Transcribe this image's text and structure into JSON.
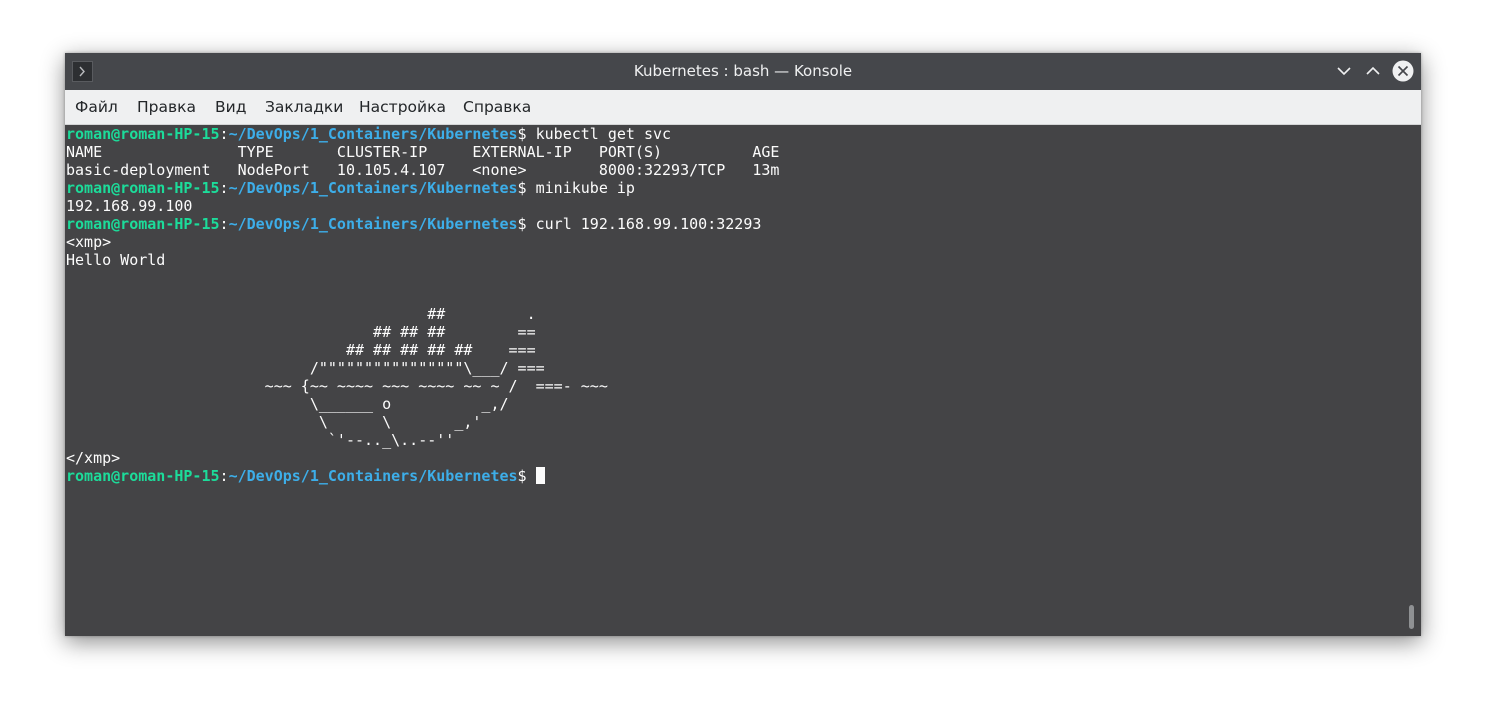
{
  "window": {
    "title": "Kubernetes : bash — Konsole",
    "icon": "terminal-icon",
    "controls": [
      "minimize-icon",
      "maximize-icon",
      "close-icon"
    ]
  },
  "menu": [
    "Файл",
    "Правка",
    "Вид",
    "Закладки",
    "Настройка",
    "Справка"
  ],
  "prompt": {
    "user": "roman@roman-HP-15",
    "colon": ":",
    "path": "~/DevOps/1_Containers/Kubernetes",
    "symbol": "$ "
  },
  "terminal": {
    "cmd1": "kubectl get svc",
    "svc_header": "NAME               TYPE       CLUSTER-IP     EXTERNAL-IP   PORT(S)          AGE",
    "svc_row": "basic-deployment   NodePort   10.105.4.107   <none>        8000:32293/TCP   13m",
    "cmd2": "minikube ip",
    "ip_output": "192.168.99.100",
    "cmd3": "curl 192.168.99.100:32293",
    "xmp_open": "<xmp>",
    "hello": "Hello World",
    "blank1": "",
    "blank2": "",
    "art1": "                                        ##         .",
    "art2": "                                  ## ## ##        ==",
    "art3": "                               ## ## ## ## ##    ===",
    "art4": "                           /\"\"\"\"\"\"\"\"\"\"\"\"\"\"\"\"\\___/ ===",
    "art5": "                      ~~~ {~~ ~~~~ ~~~ ~~~~ ~~ ~ /  ===- ~~~",
    "art6": "                           \\______ o          _,/",
    "art7": "                            \\      \\       _,'",
    "art8": "                             `'--.._\\..--''",
    "xmp_close": "</xmp>"
  },
  "colors": {
    "terminal_bg": "#444446",
    "prompt_user": "#1cdc9a",
    "prompt_path": "#3daee9",
    "text": "#fcfcfc",
    "titlebar": "#45474b",
    "menubar": "#eff0f1"
  }
}
